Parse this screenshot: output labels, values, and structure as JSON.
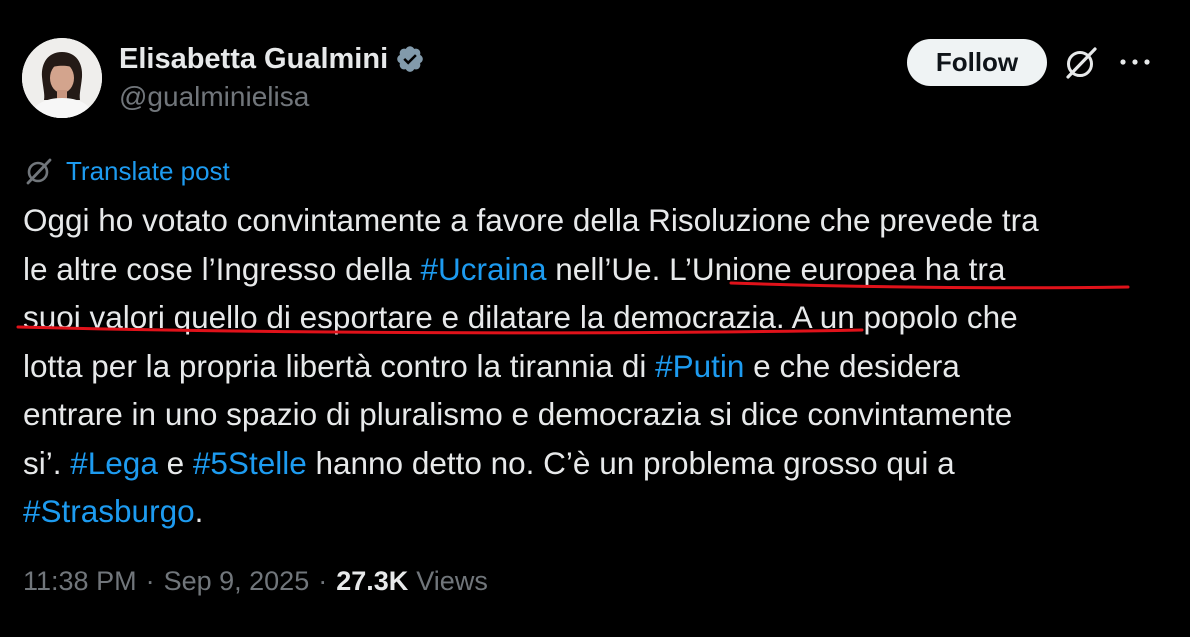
{
  "author": {
    "name": "Elisabetta Gualmini",
    "handle": "@gualminielisa",
    "verified": true
  },
  "actions": {
    "follow_label": "Follow",
    "grok_icon": "grok-icon",
    "more_icon": "more-icon"
  },
  "translate": {
    "label": "Translate post",
    "icon": "translate-icon"
  },
  "post": {
    "line1": "Oggi ho votato convintamente a favore della Risoluzione che prevede tra",
    "line2_a": "le altre cose l’Ingresso della ",
    "line2_tag": "#Ucraina",
    "line2_b": " nell’Ue. L’Unione europea ha tra",
    "line3_a": "suoi valori quello di esportare e dilatare la democrazia. A un popolo che",
    "line4_a": "lotta per la propria libertà contro la tirannia di ",
    "line4_tag": "#Putin",
    "line4_b": " e che desidera",
    "line5": "entrare in uno spazio di pluralismo e democrazia si dice convintamente",
    "line6_a": "si’. ",
    "line6_tag1": "#Lega",
    "line6_b": " e ",
    "line6_tag2": "#5Stelle",
    "line6_c": " hanno detto no. C’è un problema grosso qui a",
    "line7_tag": "#Strasburgo",
    "line7_b": "."
  },
  "meta": {
    "time": "11:38 PM",
    "separator": "·",
    "date": "Sep 9, 2025",
    "views_count": "27.3K",
    "views_label": "Views"
  },
  "colors": {
    "background": "#000000",
    "text": "#e7e9ea",
    "secondary": "#71767b",
    "link": "#1d9bf0",
    "verified": "#829aab",
    "annotation": "#e0121a"
  }
}
